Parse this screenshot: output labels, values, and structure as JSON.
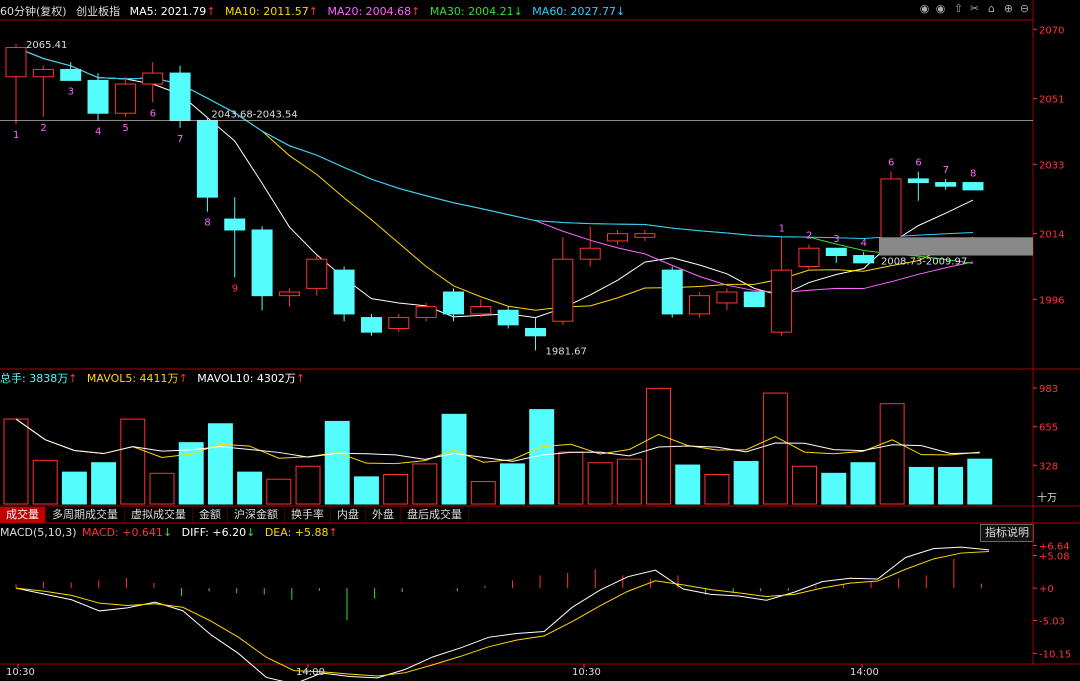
{
  "header": {
    "period": "60分钟",
    "adjust": "(复权)",
    "index_name": "创业板指",
    "ma": [
      {
        "label": "MA5: 2021.79",
        "arrow": "↑",
        "color": "#ffffff"
      },
      {
        "label": "MA10: 2011.57",
        "arrow": "↑",
        "color": "#ffd700"
      },
      {
        "label": "MA20: 2004.68",
        "arrow": "↑",
        "color": "#ff66ff"
      },
      {
        "label": "MA30: 2004.21",
        "arrow": "↓",
        "color": "#33dd33"
      },
      {
        "label": "MA60: 2027.77",
        "arrow": "↓",
        "color": "#33ccff"
      }
    ]
  },
  "toolbar": [
    "eye-icon",
    "eye-icon",
    "up-arrow-icon",
    "scissors-icon",
    "lock-icon",
    "zoom-in-icon",
    "zoom-out-icon"
  ],
  "volume_header": {
    "total": "总手: 3838万",
    "total_arrow": "↑",
    "mavol5": "MAVOL5: 4411万",
    "mavol5_arrow": "↑",
    "mavol10": "MAVOL10: 4302万",
    "mavol10_arrow": "↑"
  },
  "tabs": [
    {
      "label": "成交量",
      "active": true
    },
    {
      "label": "多周期成交量",
      "active": false
    },
    {
      "label": "虚拟成交量",
      "active": false
    },
    {
      "label": "金额",
      "active": false
    },
    {
      "label": "沪深金额",
      "active": false
    },
    {
      "label": "换手率",
      "active": false
    },
    {
      "label": "内盘",
      "active": false
    },
    {
      "label": "外盘",
      "active": false
    },
    {
      "label": "盘后成交量",
      "active": false
    }
  ],
  "macd_header": {
    "label": "MACD(5,10,3)",
    "macd": "MACD: +0.641",
    "macd_arrow": "↓",
    "diff": "DIFF: +6.20",
    "diff_arrow": "↓",
    "dea": "DEA: +5.88",
    "dea_arrow": "↑"
  },
  "indicator_button": "指标说明",
  "colors": {
    "up": "#ff3333",
    "down": "#54fcfc",
    "axis": "#aa0000",
    "grid": "#550000"
  },
  "chart_data": {
    "type": "candlestick",
    "price_ticks": [
      "2070",
      "2051",
      "2033",
      "2014",
      "1996"
    ],
    "volume_ticks": [
      "983",
      "655",
      "328"
    ],
    "volume_unit": "十万",
    "macd_ticks": [
      "+6.64",
      "+5.08",
      "+0",
      "-5.03",
      "-10.15"
    ],
    "time_labels": [
      "10:30",
      "14:00",
      "10:30",
      "14:00"
    ],
    "price_annotations": [
      "2065.41",
      "2043.68-2043.54",
      "2008.73-2009.97",
      "1981.67"
    ],
    "wave_labels": [
      "1",
      "2",
      "3",
      "4",
      "5",
      "6",
      "7",
      "8",
      "9",
      "1",
      "2",
      "3",
      "4",
      "6",
      "6",
      "7",
      "8"
    ],
    "candles": [
      {
        "o": 2057,
        "h": 2066,
        "l": 2044,
        "c": 2065
      },
      {
        "o": 2057,
        "h": 2060,
        "l": 2046,
        "c": 2059
      },
      {
        "o": 2059,
        "h": 2061,
        "l": 2056,
        "c": 2056
      },
      {
        "o": 2056,
        "h": 2058,
        "l": 2045,
        "c": 2047
      },
      {
        "o": 2047,
        "h": 2057,
        "l": 2046,
        "c": 2055
      },
      {
        "o": 2055,
        "h": 2061,
        "l": 2050,
        "c": 2058
      },
      {
        "o": 2058,
        "h": 2060,
        "l": 2043,
        "c": 2045
      },
      {
        "o": 2045,
        "h": 2046,
        "l": 2020,
        "c": 2024
      },
      {
        "o": 2018,
        "h": 2024,
        "l": 2002,
        "c": 2015
      },
      {
        "o": 2015,
        "h": 2016,
        "l": 1993,
        "c": 1997
      },
      {
        "o": 1997,
        "h": 1999,
        "l": 1994,
        "c": 1998
      },
      {
        "o": 1999,
        "h": 2008,
        "l": 1997,
        "c": 2007
      },
      {
        "o": 2004,
        "h": 2005,
        "l": 1990,
        "c": 1992
      },
      {
        "o": 1991,
        "h": 1992,
        "l": 1986,
        "c": 1987
      },
      {
        "o": 1988,
        "h": 1992,
        "l": 1987,
        "c": 1991
      },
      {
        "o": 1991,
        "h": 1995,
        "l": 1990,
        "c": 1994
      },
      {
        "o": 1998,
        "h": 1999,
        "l": 1990,
        "c": 1992
      },
      {
        "o": 1992,
        "h": 1996,
        "l": 1991,
        "c": 1994
      },
      {
        "o": 1993,
        "h": 1994,
        "l": 1988,
        "c": 1989
      },
      {
        "o": 1988,
        "h": 1991,
        "l": 1982,
        "c": 1986
      },
      {
        "o": 1990,
        "h": 2013,
        "l": 1989,
        "c": 2007
      },
      {
        "o": 2007,
        "h": 2016,
        "l": 2005,
        "c": 2010
      },
      {
        "o": 2012,
        "h": 2015,
        "l": 2011,
        "c": 2014
      },
      {
        "o": 2013,
        "h": 2015,
        "l": 2012,
        "c": 2014
      },
      {
        "o": 2004,
        "h": 2005,
        "l": 1991,
        "c": 1992
      },
      {
        "o": 1992,
        "h": 1998,
        "l": 1991,
        "c": 1997
      },
      {
        "o": 1995,
        "h": 1999,
        "l": 1993,
        "c": 1998
      },
      {
        "o": 1998,
        "h": 1998,
        "l": 1994,
        "c": 1994
      },
      {
        "o": 1987,
        "h": 2013,
        "l": 1986,
        "c": 2004
      },
      {
        "o": 2005,
        "h": 2011,
        "l": 2004,
        "c": 2010
      },
      {
        "o": 2010,
        "h": 2010,
        "l": 2006,
        "c": 2008
      },
      {
        "o": 2008,
        "h": 2009,
        "l": 2007,
        "c": 2006
      },
      {
        "o": 2012,
        "h": 2031,
        "l": 2011,
        "c": 2029
      },
      {
        "o": 2029,
        "h": 2031,
        "l": 2023,
        "c": 2028
      },
      {
        "o": 2028,
        "h": 2029,
        "l": 2026,
        "c": 2027
      },
      {
        "o": 2028,
        "h": 2028,
        "l": 2026,
        "c": 2026
      }
    ],
    "volumes": [
      720,
      370,
      270,
      350,
      720,
      260,
      520,
      680,
      270,
      210,
      320,
      700,
      230,
      250,
      340,
      760,
      190,
      340,
      800,
      440,
      350,
      380,
      980,
      330,
      250,
      360,
      940,
      320,
      260,
      350,
      850,
      310,
      310,
      380
    ],
    "macd_bars": [
      0.6,
      1.0,
      0.9,
      1.2,
      1.6,
      0.8,
      -1.2,
      -0.5,
      -0.8,
      -1.0,
      -1.8,
      -0.4,
      -5.0,
      -1.6,
      -0.6,
      0.0,
      -0.5,
      0.4,
      1.2,
      2.0,
      2.4,
      3.0,
      2.0,
      1.5,
      2.0,
      -1.0,
      -0.6,
      -0.5,
      -0.4,
      0.4,
      0.6,
      1.0,
      1.5,
      2.0,
      4.6,
      0.7
    ]
  }
}
